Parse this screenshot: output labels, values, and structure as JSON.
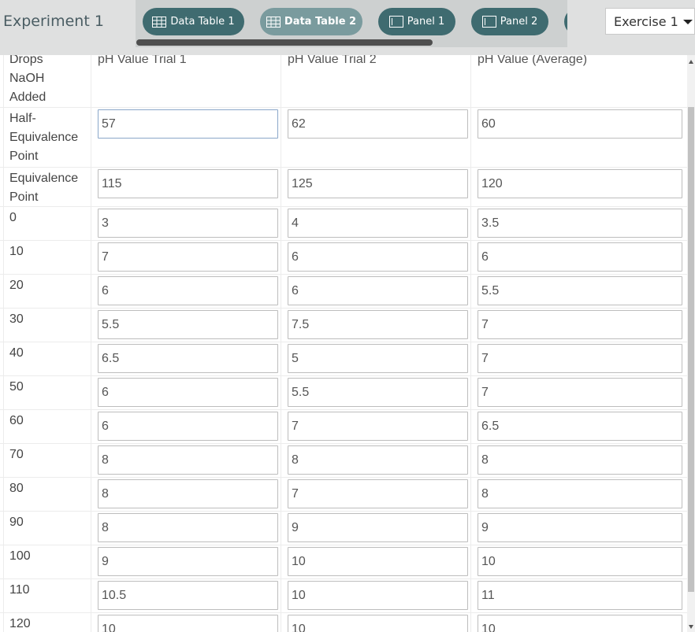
{
  "header": {
    "title": "Experiment 1"
  },
  "tabs": [
    {
      "label": "Data Table 1",
      "icon": "table-icon",
      "active": false
    },
    {
      "label": "Data Table 2",
      "icon": "table-icon",
      "active": true
    },
    {
      "label": "Panel 1",
      "icon": "panel-icon",
      "active": false
    },
    {
      "label": "Panel 2",
      "icon": "panel-icon",
      "active": false
    }
  ],
  "exercise_select": {
    "value": "Exercise 1"
  },
  "table": {
    "headers": [
      "Drops NaOH Added",
      "pH Value Trial 1",
      "pH Value Trial 2",
      "pH Value (Average)"
    ],
    "rows": [
      {
        "label": "Half-Equivalence Point",
        "values": [
          "57",
          "62",
          "60"
        ]
      },
      {
        "label": "Equivalence Point",
        "values": [
          "115",
          "125",
          "120"
        ]
      },
      {
        "label": "0",
        "values": [
          "3",
          "4",
          "3.5"
        ]
      },
      {
        "label": "10",
        "values": [
          "7",
          "6",
          "6"
        ]
      },
      {
        "label": "20",
        "values": [
          "6",
          "6",
          "5.5"
        ]
      },
      {
        "label": "30",
        "values": [
          "5.5",
          "7.5",
          "7"
        ]
      },
      {
        "label": "40",
        "values": [
          "6.5",
          "5",
          "7"
        ]
      },
      {
        "label": "50",
        "values": [
          "6",
          "5.5",
          "7"
        ]
      },
      {
        "label": "60",
        "values": [
          "6",
          "7",
          "6.5"
        ]
      },
      {
        "label": "70",
        "values": [
          "8",
          "8",
          "8"
        ]
      },
      {
        "label": "80",
        "values": [
          "8",
          "7",
          "8"
        ]
      },
      {
        "label": "90",
        "values": [
          "8",
          "9",
          "9"
        ]
      },
      {
        "label": "100",
        "values": [
          "9",
          "10",
          "10"
        ]
      },
      {
        "label": "110",
        "values": [
          "10.5",
          "10",
          "11"
        ]
      },
      {
        "label": "120",
        "values": [
          "10",
          "10",
          "10"
        ]
      }
    ]
  }
}
